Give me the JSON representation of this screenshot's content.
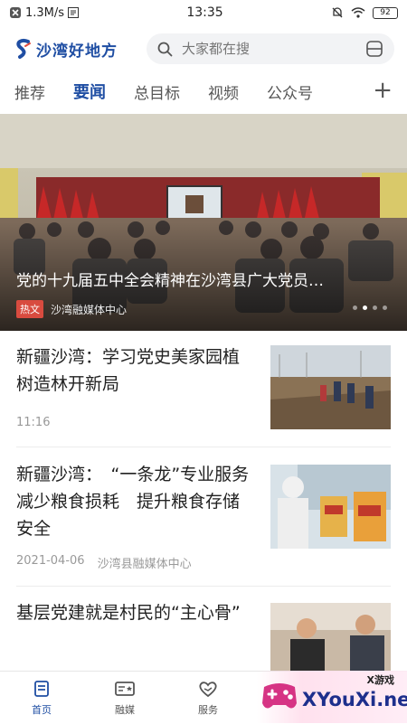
{
  "status_bar": {
    "speed": "1.3M/s",
    "time": "13:35",
    "battery": "92"
  },
  "header": {
    "logo_text": "沙湾好地方",
    "search_placeholder": "大家都在搜"
  },
  "tabs": {
    "items": [
      "推荐",
      "要闻",
      "总目标",
      "视频",
      "公众号"
    ],
    "active_index": 1,
    "add_symbol": "+"
  },
  "hero": {
    "title": "党的十九届五中全会精神在沙湾县广大党员…",
    "badge": "热文",
    "source": "沙湾融媒体中心",
    "slide_count": 4,
    "active_slide": 1
  },
  "news": [
    {
      "title": "新疆沙湾：学习党史美家园植树造林开新局",
      "time": "11:16",
      "source": ""
    },
    {
      "title": "新疆沙湾：　“一条龙”专业服务　减少粮食损耗　提升粮食存储安全",
      "time": "2021-04-06",
      "source": "沙湾县融媒体中心"
    },
    {
      "title": "基层党建就是村民的“主心骨”",
      "time": "",
      "source": ""
    }
  ],
  "bottom_nav": {
    "items": [
      {
        "label": "首页",
        "icon": "home-icon"
      },
      {
        "label": "融媒",
        "icon": "media-icon"
      },
      {
        "label": "服务",
        "icon": "service-icon"
      }
    ],
    "active_index": 0
  },
  "watermark": {
    "small_text": "X游戏",
    "brand_text": "XYouXi.net"
  },
  "colors": {
    "accent": "#1f4ea3",
    "hot_badge": "#d84b3f"
  }
}
